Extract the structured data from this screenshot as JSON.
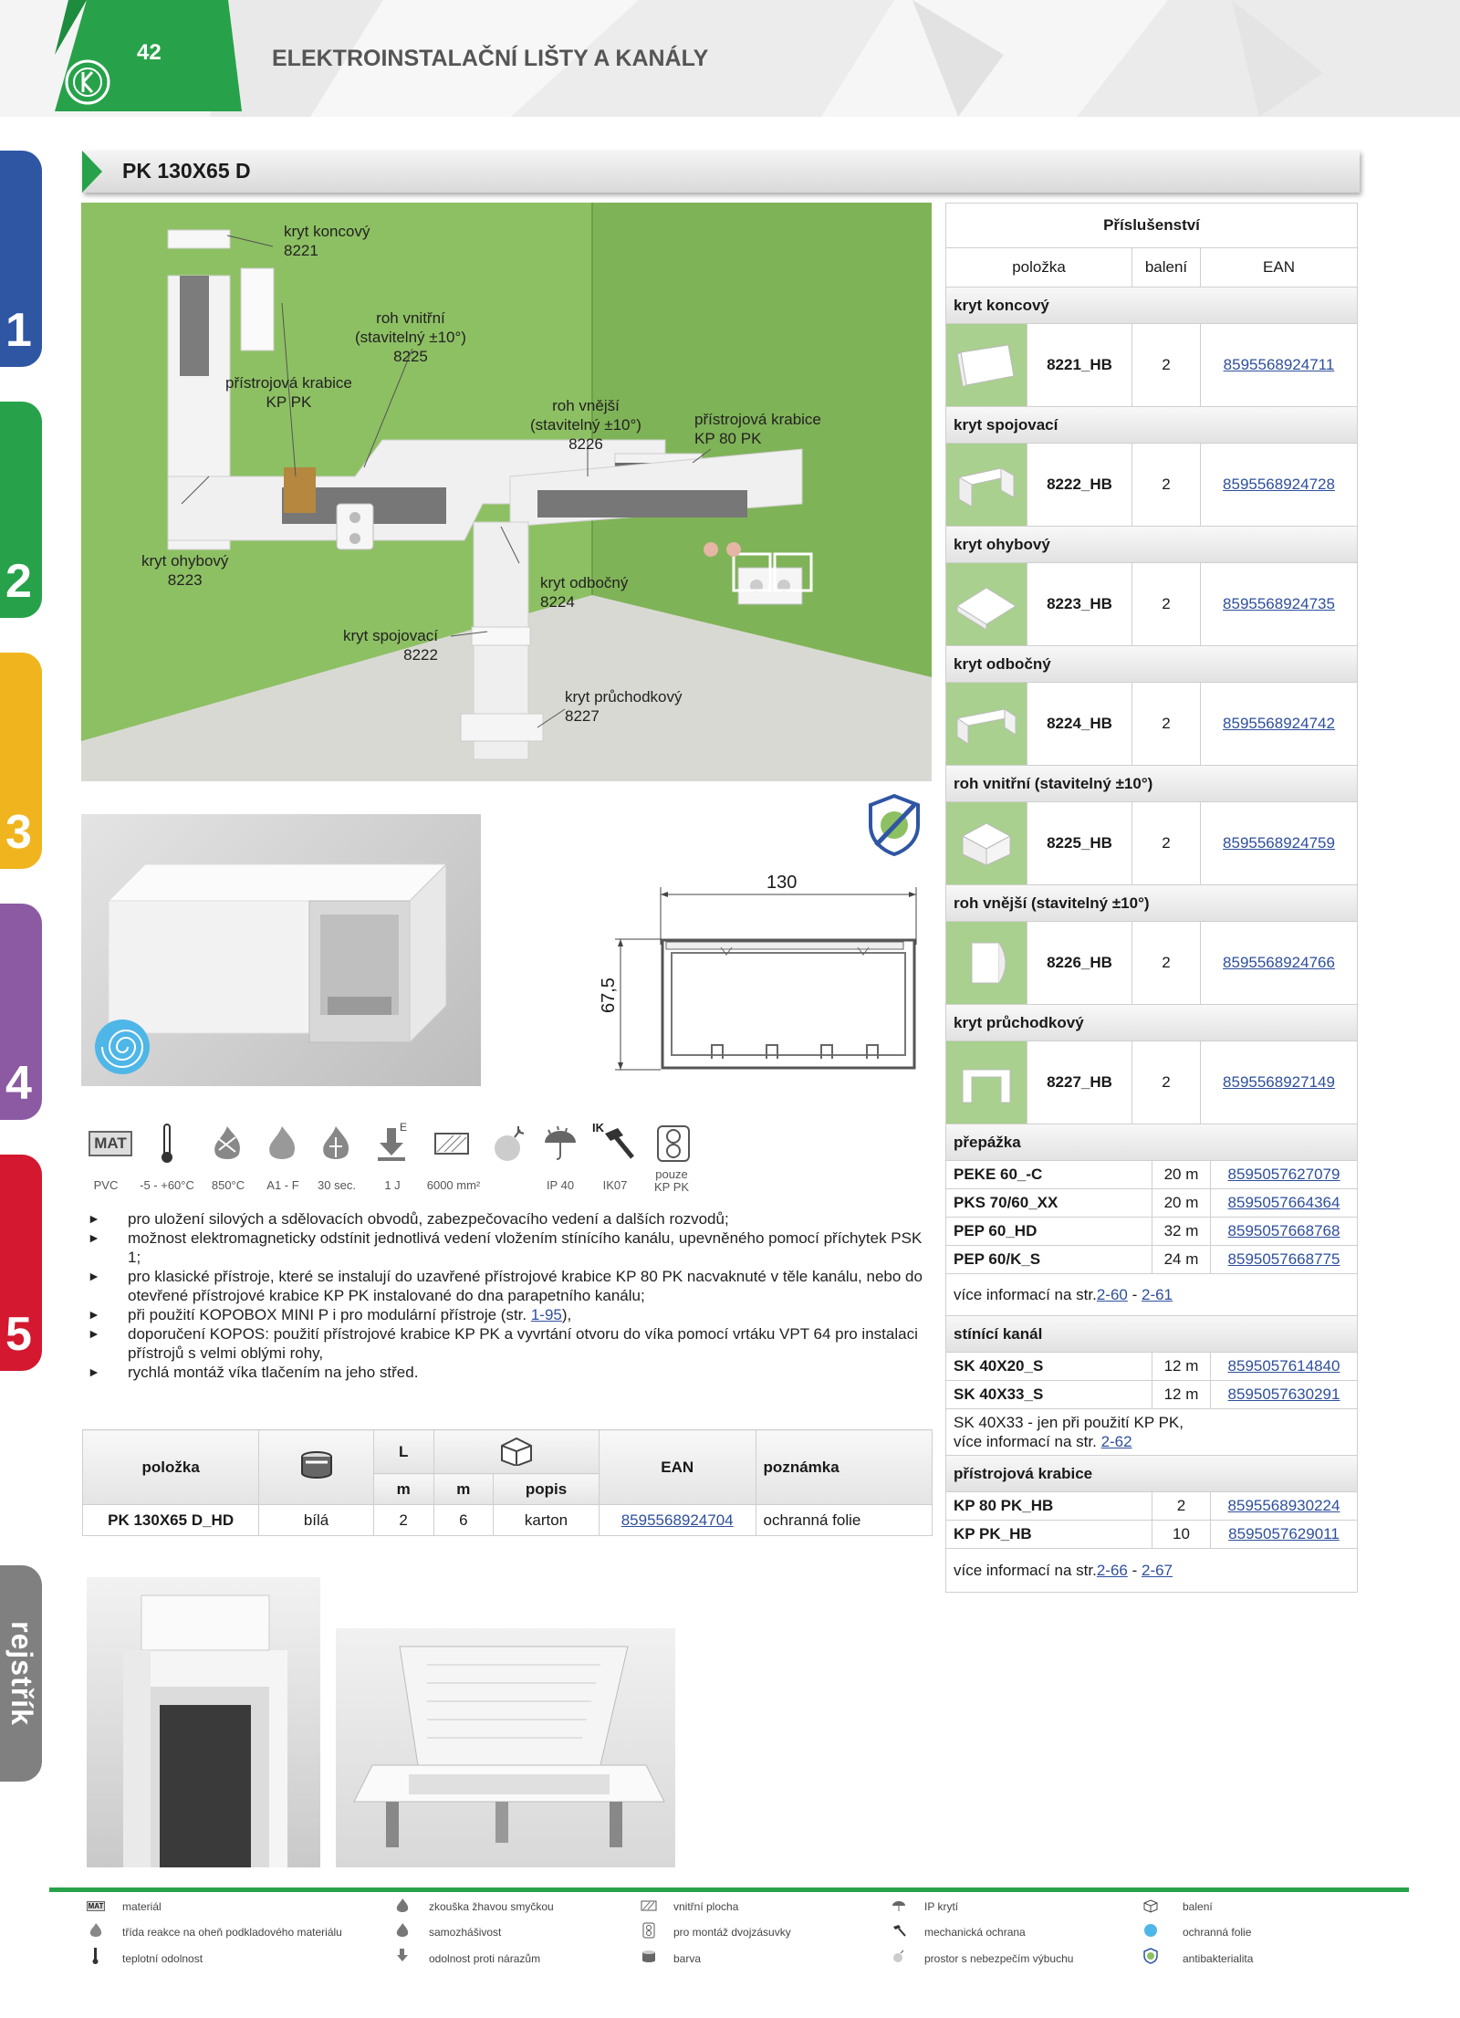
{
  "header": {
    "page_number": "42",
    "title": "ELEKTROINSTALAČNÍ LIŠTY A KANÁLY"
  },
  "colors": {
    "green": "#27a24a",
    "blue": "#2f56a3",
    "yellow": "#f0b51e",
    "purple": "#8b5aa3",
    "red": "#d3182f",
    "gray": "#808080",
    "wall": "#8dc063"
  },
  "side_tabs": [
    "1",
    "2",
    "3",
    "4",
    "5",
    "rejstřík"
  ],
  "product_title": "PK 130X65 D",
  "scene_labels": [
    {
      "text": "kryt koncový\n8221"
    },
    {
      "text": "roh vnitřní\n(stavitelný ±10°)\n8225"
    },
    {
      "text": "přístrojová krabice\nKP PK"
    },
    {
      "text": "roh vnější\n(stavitelný ±10°)\n8226"
    },
    {
      "text": "přístrojová krabice\nKP 80 PK"
    },
    {
      "text": "kryt ohybový\n8223"
    },
    {
      "text": "kryt odbočný\n8224"
    },
    {
      "text": "kryt spojovací\n8222"
    },
    {
      "text": "kryt průchodkový\n8227"
    }
  ],
  "drawing": {
    "width": "130",
    "height": "67,5"
  },
  "properties": {
    "mat_icon_text": "MAT",
    "ik_icon_text": "IK",
    "e_icon_text": "E",
    "labels": [
      "PVC",
      "-5 - +60°C",
      "850°C",
      "A1 - F",
      "30 sec.",
      "1 J",
      "6000 mm²",
      "IP 40",
      "IK07",
      "pouze\nKP PK"
    ]
  },
  "bullets": [
    {
      "text": "pro uložení silových a sdělovacích obvodů, zabezpečovacího vedení a dalších rozvodů;"
    },
    {
      "text": "možnost elektromagneticky odstínit jednotlivá vedení vložením stínícího kanálu, upevněného pomocí příchytek PSK 1;"
    },
    {
      "text": "pro klasické přístroje, které se instalují do uzavřené přístrojové krabice KP 80 PK nacvaknuté v těle kanálu, nebo do otevřené přístrojové krabice KP PK instalované do dna parapetního kanálu;"
    },
    {
      "text": "při použití KOPOBOX MINI P i pro modulární přístroje (str. ",
      "link": "1-95",
      "after": "),"
    },
    {
      "text": "doporučení KOPOS: použití přístrojové krabice KP PK a vyvrtání otvoru do víka pomocí vrtáku VPT 64 pro instalaci přístrojů s velmi oblými rohy,"
    },
    {
      "text": "rychlá montáž víka tlačením na jeho střed."
    }
  ],
  "main_table": {
    "h_item": "položka",
    "h_L": "L",
    "h_m1": "m",
    "h_m2": "m",
    "h_popis": "popis",
    "h_ean": "EAN",
    "h_note": "poznámka",
    "row": {
      "item": "PK 130X65 D_HD",
      "color": "bílá",
      "L": "2",
      "qty": "6",
      "popis": "karton",
      "ean": "8595568924704",
      "note": "ochranná folie"
    }
  },
  "accessories": {
    "title": "Příslušenství",
    "col_item": "položka",
    "col_pack": "balení",
    "col_ean": "EAN",
    "products": [
      {
        "section": "kryt koncový",
        "item": "8221_HB",
        "pack": "2",
        "ean": "8595568924711"
      },
      {
        "section": "kryt spojovací",
        "item": "8222_HB",
        "pack": "2",
        "ean": "8595568924728"
      },
      {
        "section": "kryt ohybový",
        "item": "8223_HB",
        "pack": "2",
        "ean": "8595568924735"
      },
      {
        "section": "kryt odbočný",
        "item": "8224_HB",
        "pack": "2",
        "ean": "8595568924742"
      },
      {
        "section": "roh vnitřní (stavitelný ±10°)",
        "item": "8225_HB",
        "pack": "2",
        "ean": "8595568924759"
      },
      {
        "section": "roh vnější (stavitelný ±10°)",
        "item": "8226_HB",
        "pack": "2",
        "ean": "8595568924766"
      },
      {
        "section": "kryt průchodkový",
        "item": "8227_HB",
        "pack": "2",
        "ean": "8595568927149"
      }
    ],
    "prepazka": {
      "section": "přepážka",
      "rows": [
        {
          "item": "PEKE 60_-C",
          "pack": "20 m",
          "ean": "8595057627079"
        },
        {
          "item": "PKS 70/60_XX",
          "pack": "20 m",
          "ean": "8595057664364"
        },
        {
          "item": "PEP 60_HD",
          "pack": "32 m",
          "ean": "8595057668768"
        },
        {
          "item": "PEP 60/K_S",
          "pack": "24 m",
          "ean": "8595057668775"
        }
      ],
      "note_pre": "více informací na str. ",
      "note_l1": "2-60",
      "note_mid": " - ",
      "note_l2": "2-61"
    },
    "stinici": {
      "section": "stínící kanál",
      "rows": [
        {
          "item": "SK 40X20_S",
          "pack": "12 m",
          "ean": "8595057614840"
        },
        {
          "item": "SK 40X33_S",
          "pack": "12 m",
          "ean": "8595057630291"
        }
      ],
      "note1": "SK 40X33 - jen při použití KP PK,",
      "note_pre": "více informací na str. ",
      "note_l1": "2-62"
    },
    "krabice": {
      "section": "přístrojová krabice",
      "rows": [
        {
          "item": "KP 80 PK_HB",
          "pack": "2",
          "ean": "8595568930224"
        },
        {
          "item": "KP PK_HB",
          "pack": "10",
          "ean": "8595057629011"
        }
      ],
      "note_pre": "více informací na str. ",
      "note_l1": "2-66",
      "note_mid": " - ",
      "note_l2": "2-67"
    }
  },
  "legend": [
    [
      "materiál",
      "třída reakce na oheň podkladového materiálu",
      "teplotní odolnost"
    ],
    [
      "zkouška žhavou smyčkou",
      "samozhášivost",
      "odolnost proti nárazům"
    ],
    [
      "vnitřní plocha",
      "pro montáž dvojzásuvky",
      "barva"
    ],
    [
      "IP krytí",
      "mechanická ochrana",
      "prostor s nebezpečím výbuchu"
    ],
    [
      "balení",
      "ochranná folie",
      "antibakterialita"
    ]
  ]
}
